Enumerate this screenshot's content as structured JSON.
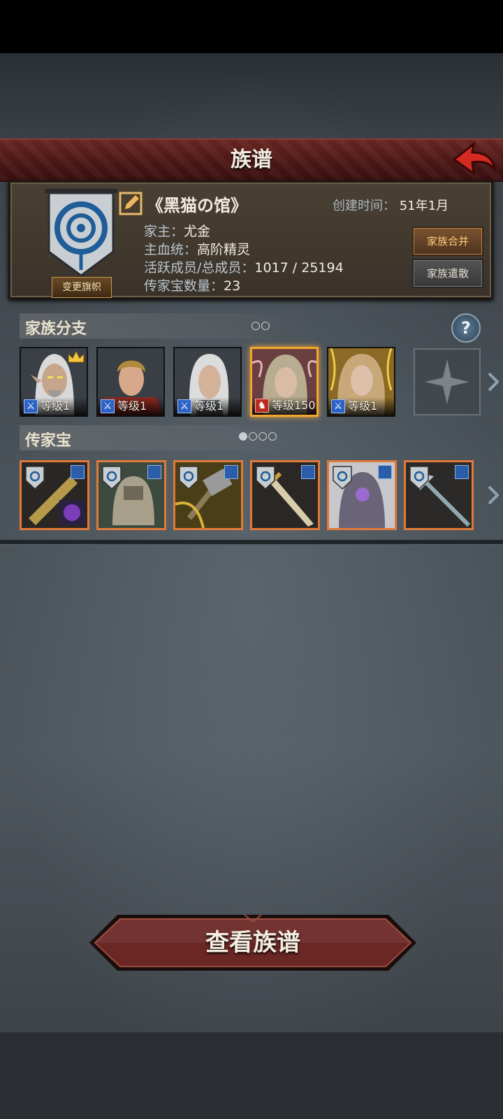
{
  "header": {
    "title": "族谱",
    "back_icon": "back-arrow-icon"
  },
  "family": {
    "name": "《黑猫の馆》",
    "created_label": "创建时间：",
    "created_value": "51年1月",
    "head_label": "家主：",
    "head_value": "尤金",
    "bloodline_label": "主血统：",
    "bloodline_value": "高阶精灵",
    "members_label": "活跃成员/总成员：",
    "members_value": "1017 / 25194",
    "heirloom_count_label": "传家宝数量：",
    "heirloom_count_value": "23",
    "change_banner_label": "变更旗帜",
    "merge_label": "家族合并",
    "disband_label": "家族遣散"
  },
  "branches": {
    "title": "家族分支",
    "help_label": "?",
    "pages": 2,
    "active_page": 0,
    "cards": [
      {
        "level": "等级1",
        "icon": "sword-class-icon",
        "leader": true,
        "selected": false
      },
      {
        "level": "等级1",
        "icon": "sword-class-icon",
        "leader": false,
        "selected": false
      },
      {
        "level": "等级1",
        "icon": "sword-class-icon",
        "leader": false,
        "selected": false
      },
      {
        "level": "等级150",
        "icon": "horse-class-icon",
        "leader": false,
        "selected": true
      },
      {
        "level": "等级1",
        "icon": "sword-class-icon",
        "leader": false,
        "selected": false
      }
    ]
  },
  "heirlooms": {
    "title": "传家宝",
    "pages": 4,
    "active_page": 0,
    "items": [
      "dagger-heirloom",
      "armor-heirloom",
      "hammer-heirloom",
      "sword-heirloom",
      "plate-heirloom",
      "spear-heirloom"
    ]
  },
  "main_button": {
    "label": "查看族谱"
  },
  "colors": {
    "accent_orange": "#e07a3a",
    "header_red": "#5a1d1b",
    "selected_gold": "#f3a52d"
  }
}
